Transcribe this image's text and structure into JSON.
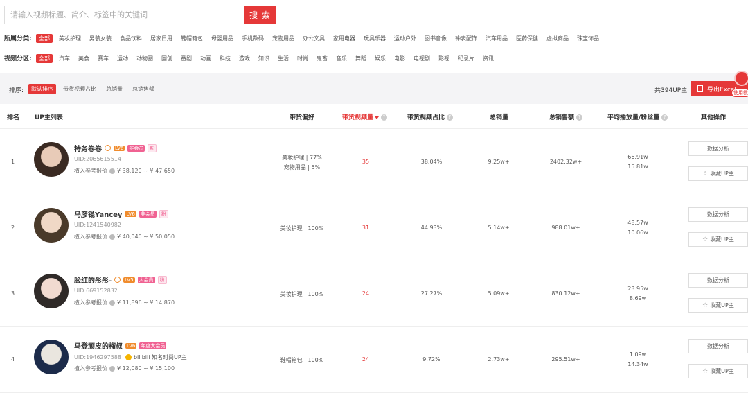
{
  "search": {
    "placeholder": "请输入视频标题、简介、标签中的关键词",
    "button": "搜 索"
  },
  "category_filter": {
    "label": "所属分类:",
    "items": [
      "全部",
      "美妆护理",
      "男装女装",
      "食品饮料",
      "居家日用",
      "鞋帽箱包",
      "母婴用品",
      "手机数码",
      "宠物用品",
      "办公文具",
      "家用电器",
      "玩具乐器",
      "运动户外",
      "图书音像",
      "钟表配饰",
      "汽车用品",
      "医药保健",
      "虚拟商品",
      "珠宝饰品"
    ]
  },
  "video_filter": {
    "label": "视频分区:",
    "items": [
      "全部",
      "汽车",
      "美食",
      "赛车",
      "运动",
      "动物圈",
      "国创",
      "番剧",
      "动画",
      "科技",
      "游戏",
      "知识",
      "生活",
      "时尚",
      "鬼畜",
      "音乐",
      "舞蹈",
      "娱乐",
      "电影",
      "电视剧",
      "影视",
      "纪录片",
      "资讯"
    ]
  },
  "sort": {
    "label": "排序:",
    "items": [
      "默认排序",
      "带货视频占比",
      "总销量",
      "总销售额"
    ],
    "total": "共394UP主",
    "export": "导出Excel",
    "float_tag": "使用教"
  },
  "table": {
    "headers": {
      "rank": "排名",
      "up_list": "UP主列表",
      "preference": "带货偏好",
      "video_count": "带货视频量",
      "video_ratio": "带货视频占比",
      "sales": "总销量",
      "revenue": "总销售额",
      "avg_play": "平均播放量/粉丝量",
      "ops": "其他操作"
    },
    "rows": [
      {
        "rank": "1",
        "name": "特务卷卷",
        "level": "LV6",
        "member": "非会员",
        "fen": "粉",
        "uid": "UID:2065615514",
        "price": "植入参考报价",
        "price_value": "¥ 38,120 ~ ¥ 47,650",
        "pref_1": "美妆护理 | 77%",
        "pref_2": "宠物用品 | 5%",
        "video_count": "35",
        "ratio": "38.04%",
        "sales": "9.25w+",
        "revenue": "2402.32w+",
        "avg_play": "66.91w",
        "fans": "15.81w",
        "btn_analysis": "数据分析",
        "btn_fav": "收藏UP主"
      },
      {
        "rank": "2",
        "name": "马彦锟Yancey",
        "level": "LV6",
        "member": "非会员",
        "fen": "粉",
        "uid": "UID:1241540982",
        "price": "植入参考报价",
        "price_value": "¥ 40,040 ~ ¥ 50,050",
        "pref_1": "美妆护理 | 100%",
        "pref_2": "",
        "video_count": "31",
        "ratio": "44.93%",
        "sales": "5.14w+",
        "revenue": "988.01w+",
        "avg_play": "48.57w",
        "fans": "10.06w",
        "btn_analysis": "数据分析",
        "btn_fav": "收藏UP主"
      },
      {
        "rank": "3",
        "name": "脸红的彤彤-",
        "level": "LV5",
        "member": "大会员",
        "fen": "粉",
        "uid": "UID:669152832",
        "price": "植入参考报价",
        "price_value": "¥ 11,896 ~ ¥ 14,870",
        "pref_1": "美妆护理 | 100%",
        "pref_2": "",
        "video_count": "24",
        "ratio": "27.27%",
        "sales": "5.09w+",
        "revenue": "830.12w+",
        "avg_play": "23.95w",
        "fans": "8.69w",
        "btn_analysis": "数据分析",
        "btn_fav": "收藏UP主"
      },
      {
        "rank": "4",
        "name": "马登顽皮的榴叔",
        "level": "LV6",
        "member": "年度大会员",
        "fen": "",
        "uid": "UID:1946297588",
        "bili": "bilibili 知名时尚UP主",
        "price": "植入参考报价",
        "price_value": "¥ 12,080 ~ ¥ 15,100",
        "pref_1": "鞋帽箱包 | 100%",
        "pref_2": "",
        "video_count": "24",
        "ratio": "9.72%",
        "sales": "2.73w+",
        "revenue": "295.51w+",
        "avg_play": "1.09w",
        "fans": "14.34w",
        "btn_analysis": "数据分析",
        "btn_fav": "收藏UP主"
      }
    ]
  },
  "colors": {
    "accent": "#e53838",
    "level": "#f08c2d",
    "member": "#f06292"
  }
}
